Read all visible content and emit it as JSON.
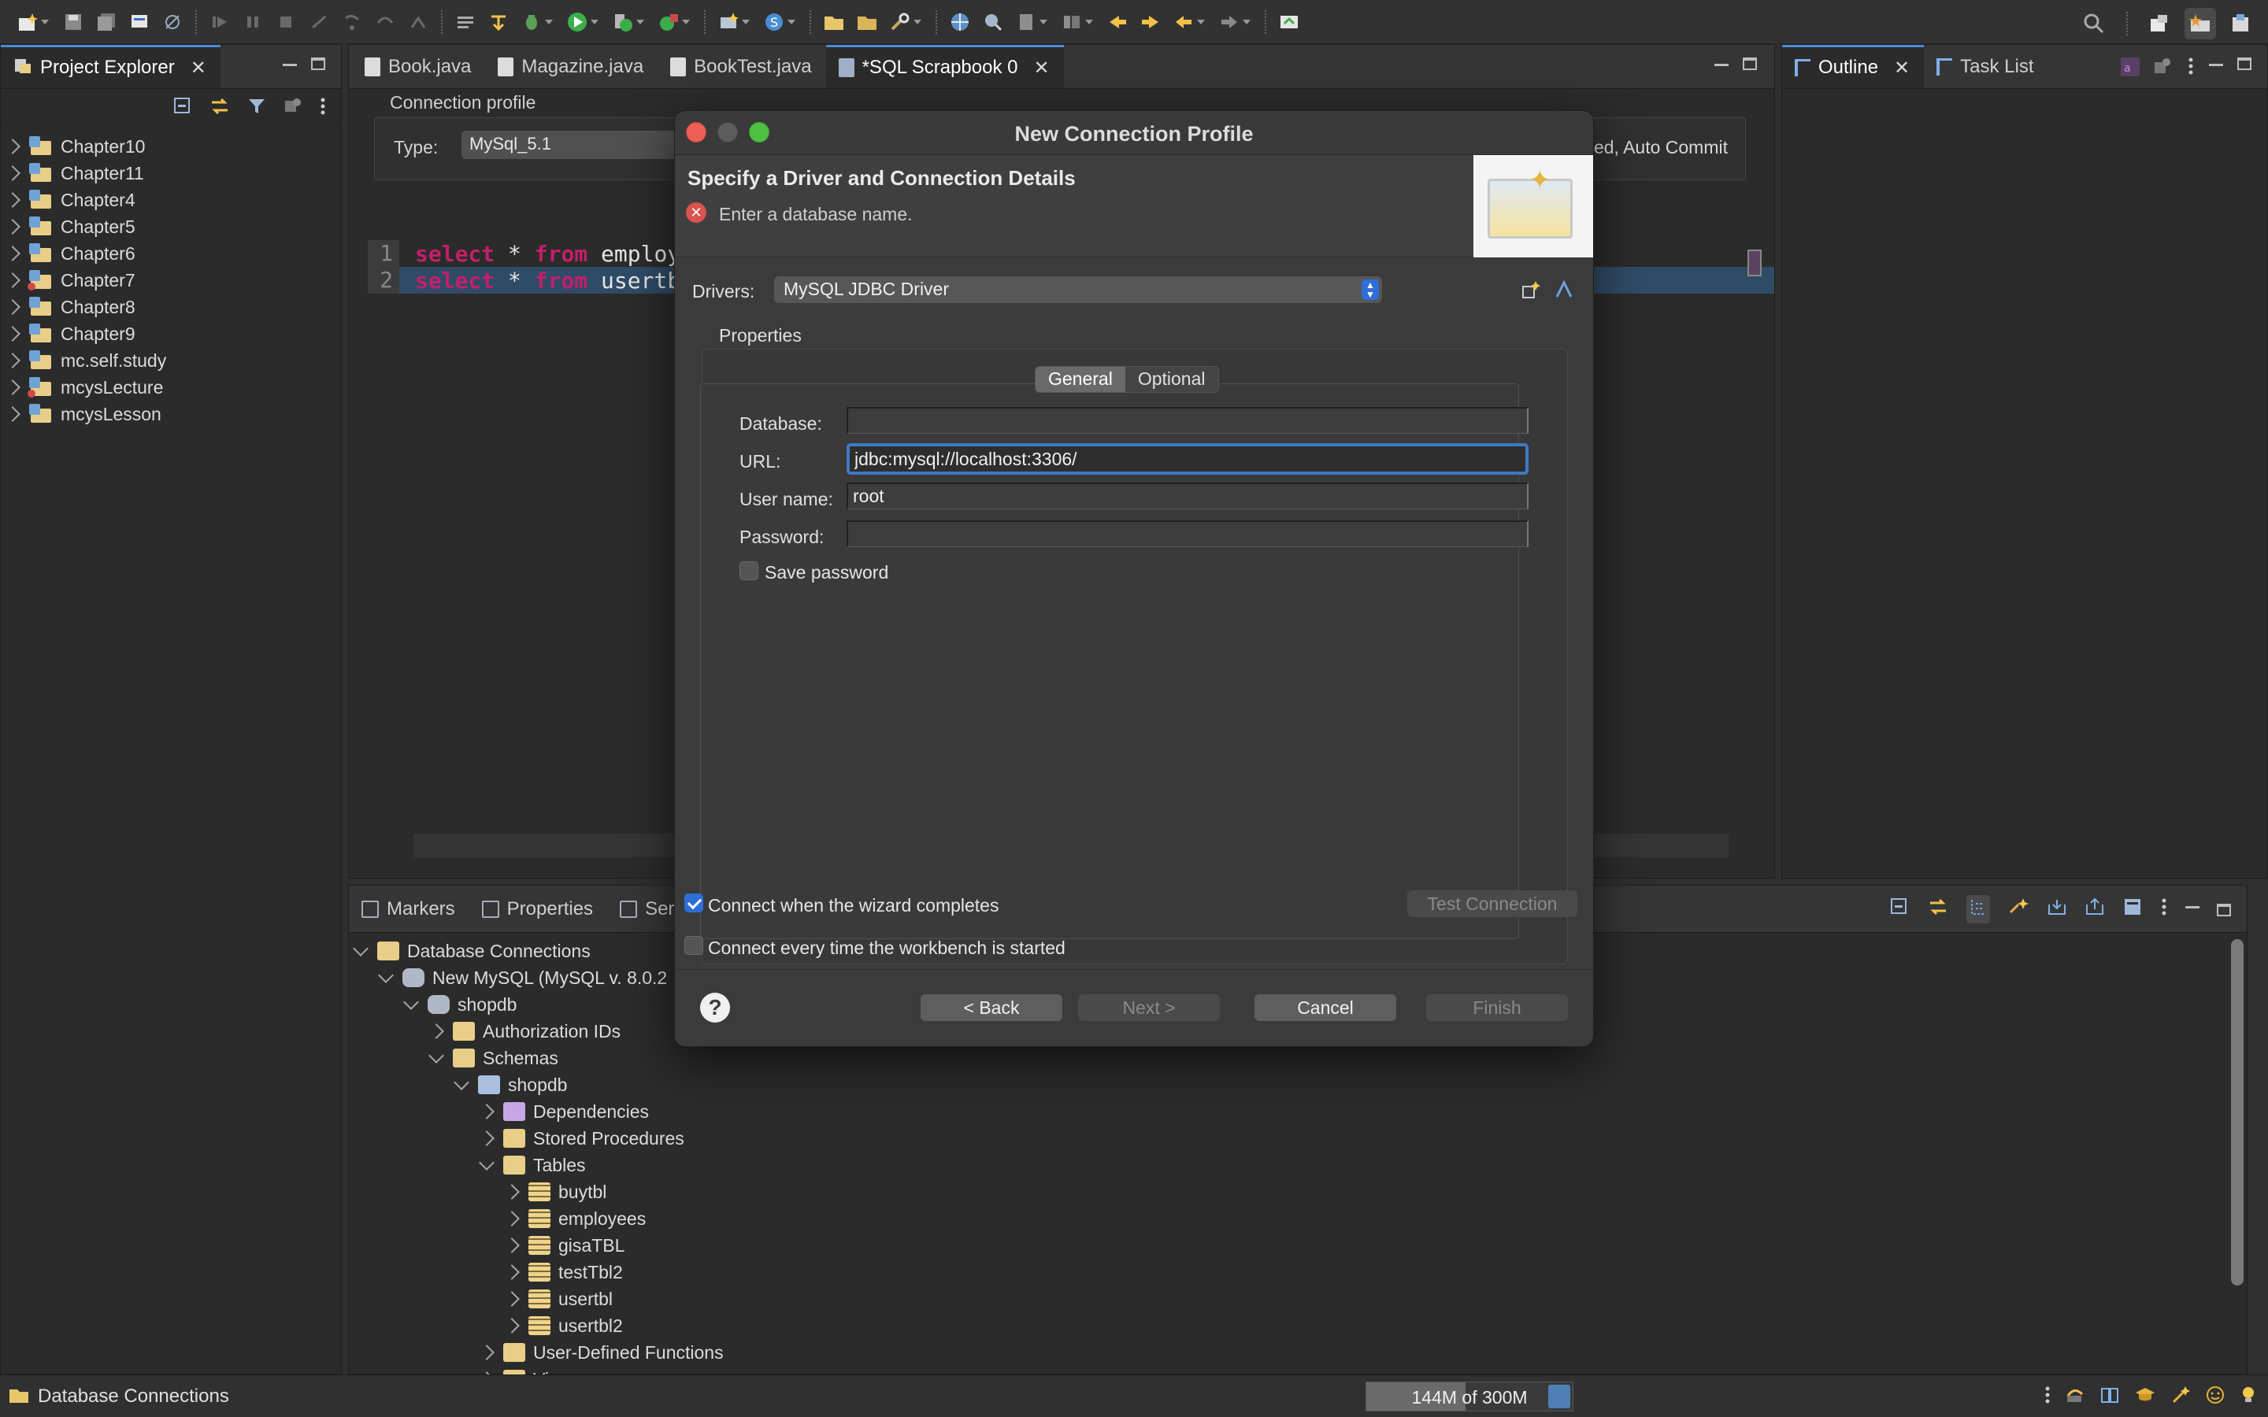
{
  "toolbar": {
    "perspective_icons": [
      "open-perspective-icon",
      "java-ee-perspective-icon",
      "java-perspective-icon"
    ]
  },
  "project_explorer": {
    "tab_label": "Project Explorer",
    "close_glyph": "✕",
    "items": [
      {
        "label": "Chapter10",
        "error": false
      },
      {
        "label": "Chapter11",
        "error": false
      },
      {
        "label": "Chapter4",
        "error": false
      },
      {
        "label": "Chapter5",
        "error": false
      },
      {
        "label": "Chapter6",
        "error": false
      },
      {
        "label": "Chapter7",
        "error": true
      },
      {
        "label": "Chapter8",
        "error": false
      },
      {
        "label": "Chapter9",
        "error": false
      },
      {
        "label": "mc.self.study",
        "error": false
      },
      {
        "label": "mcysLecture",
        "error": true
      },
      {
        "label": "mcysLesson",
        "error": false
      }
    ]
  },
  "editor": {
    "tabs": [
      {
        "label": "Book.java",
        "active": false
      },
      {
        "label": "Magazine.java",
        "active": false
      },
      {
        "label": "BookTest.java",
        "active": false
      },
      {
        "label": "*SQL Scrapbook 0",
        "active": true
      }
    ],
    "connection_profile_label": "Connection profile",
    "type_label": "Type:",
    "type_value": "MySql_5.1",
    "connection_status": "ed, Auto Commit",
    "code_lines": [
      {
        "num": "1",
        "kw1": "select",
        "mid": " * ",
        "kw2": "from",
        "rest": " employe"
      },
      {
        "num": "2",
        "kw1": "select",
        "mid": " * ",
        "kw2": "from",
        "rest": " usertbl;"
      }
    ]
  },
  "outline": {
    "tabs": [
      {
        "label": "Outline",
        "active": true
      },
      {
        "label": "Task List",
        "active": false
      }
    ]
  },
  "bottom": {
    "tabs": [
      {
        "label": "Markers"
      },
      {
        "label": "Properties"
      },
      {
        "label": "Serv"
      }
    ],
    "tree": [
      {
        "label": "Database Connections",
        "level": 0,
        "expanded": true,
        "icon": "folder"
      },
      {
        "label": "New MySQL (MySQL v. 8.0.2",
        "level": 1,
        "expanded": true,
        "icon": "db"
      },
      {
        "label": "shopdb",
        "level": 2,
        "expanded": true,
        "icon": "db"
      },
      {
        "label": "Authorization IDs",
        "level": 3,
        "expanded": false,
        "icon": "folder"
      },
      {
        "label": "Schemas",
        "level": 3,
        "expanded": true,
        "icon": "folder"
      },
      {
        "label": "shopdb",
        "level": 4,
        "expanded": true,
        "icon": "schema"
      },
      {
        "label": "Dependencies",
        "level": 5,
        "expanded": false,
        "icon": "folder-purple"
      },
      {
        "label": "Stored Procedures",
        "level": 5,
        "expanded": false,
        "icon": "folder"
      },
      {
        "label": "Tables",
        "level": 5,
        "expanded": true,
        "icon": "folder"
      },
      {
        "label": "buytbl",
        "level": 6,
        "expanded": false,
        "icon": "table"
      },
      {
        "label": "employees",
        "level": 6,
        "expanded": false,
        "icon": "table"
      },
      {
        "label": "gisaTBL",
        "level": 6,
        "expanded": false,
        "icon": "table"
      },
      {
        "label": "testTbl2",
        "level": 6,
        "expanded": false,
        "icon": "table"
      },
      {
        "label": "usertbl",
        "level": 6,
        "expanded": false,
        "icon": "table"
      },
      {
        "label": "usertbl2",
        "level": 6,
        "expanded": false,
        "icon": "table"
      },
      {
        "label": "User-Defined Functions",
        "level": 5,
        "expanded": false,
        "icon": "folder"
      },
      {
        "label": "Views",
        "level": 5,
        "expanded": false,
        "icon": "folder"
      }
    ]
  },
  "status": {
    "text": "Database Connections",
    "heap_used": 144,
    "heap_total": 300,
    "heap_text": "144M of 300M"
  },
  "dialog": {
    "title": "New Connection Profile",
    "heading": "Specify a Driver and Connection Details",
    "error_message": "Enter a database name.",
    "drivers_label": "Drivers:",
    "driver_value": "MySQL JDBC Driver",
    "properties_label": "Properties",
    "tabs": [
      {
        "label": "General",
        "active": true
      },
      {
        "label": "Optional",
        "active": false
      }
    ],
    "fields": {
      "database_label": "Database:",
      "database_value": "",
      "url_label": "URL:",
      "url_value": "jdbc:mysql://localhost:3306/",
      "username_label": "User name:",
      "username_value": "root",
      "password_label": "Password:",
      "password_value": ""
    },
    "save_password_label": "Save password",
    "save_password_checked": false,
    "connect_wizard_label": "Connect when the wizard completes",
    "connect_wizard_checked": true,
    "connect_startup_label": "Connect every time the workbench is started",
    "connect_startup_checked": false,
    "test_connection_label": "Test Connection",
    "back_label": "< Back",
    "next_label": "Next >",
    "cancel_label": "Cancel",
    "finish_label": "Finish",
    "help_glyph": "?",
    "error_glyph": "✕"
  }
}
